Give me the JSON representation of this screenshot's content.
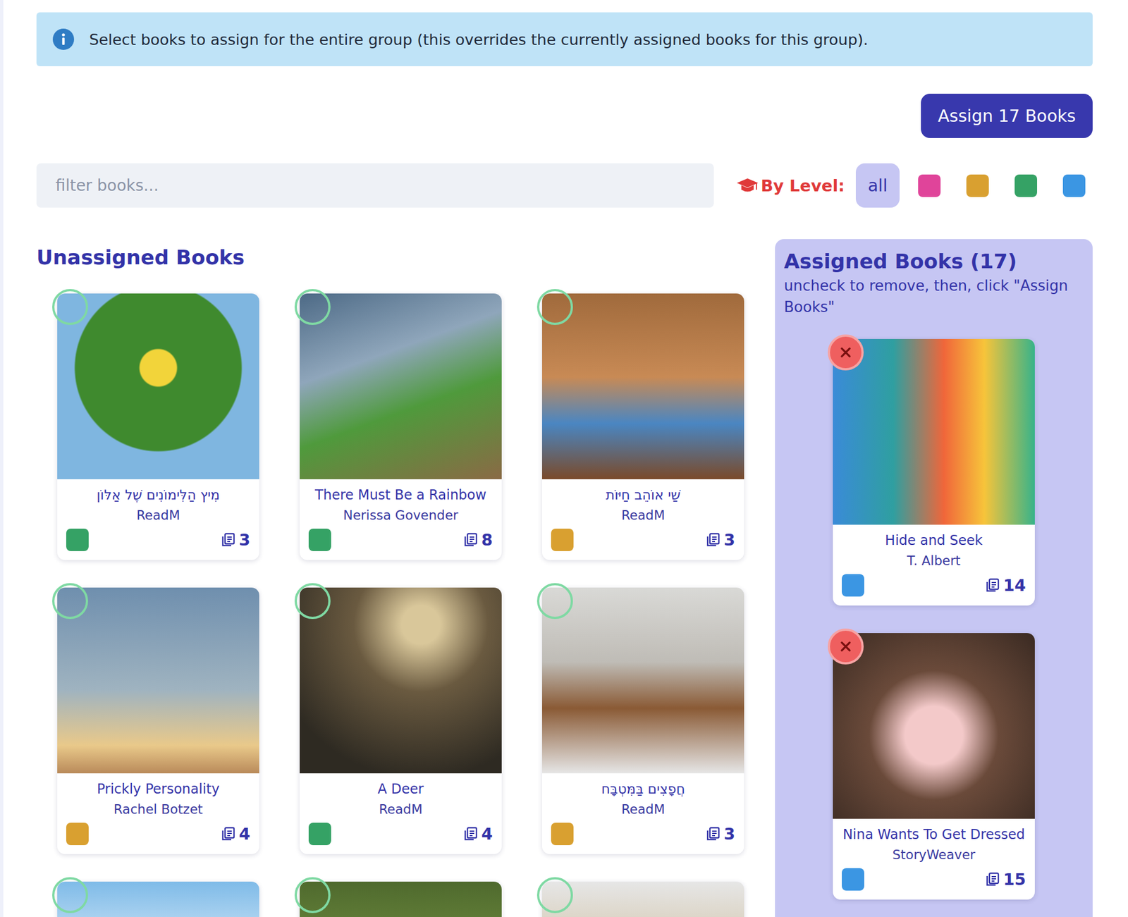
{
  "banner": {
    "text": "Select books to assign for the entire group (this overrides the currently assigned books for this group)."
  },
  "assign_button": {
    "label": "Assign 17 Books"
  },
  "filter": {
    "placeholder": "filter books..."
  },
  "level_filter": {
    "label": "By Level:",
    "options": [
      {
        "label": "all",
        "selected": true
      },
      {
        "color": "#e0449a",
        "selected": false
      },
      {
        "color": "#d9a030",
        "selected": false
      },
      {
        "color": "#35a265",
        "selected": false
      },
      {
        "color": "#3b96e3",
        "selected": false
      }
    ]
  },
  "unassigned": {
    "title": "Unassigned Books",
    "books": [
      {
        "title": "מִיץ הַלִּימוֹנִים שֶׁל אַלּוֹן",
        "author": "ReadM",
        "color": "#35a265",
        "pages": "3",
        "checked": false
      },
      {
        "title": "There Must Be a Rainbow",
        "author": "Nerissa Govender",
        "color": "#35a265",
        "pages": "8",
        "checked": false
      },
      {
        "title": "שַׁי אוֹהֵב חַיּוֹת",
        "author": "ReadM",
        "color": "#d9a030",
        "pages": "3",
        "checked": false
      },
      {
        "title": "Prickly Personality",
        "author": "Rachel Botzet",
        "color": "#d9a030",
        "pages": "4",
        "checked": false
      },
      {
        "title": "A Deer",
        "author": "ReadM",
        "color": "#35a265",
        "pages": "4",
        "checked": false
      },
      {
        "title": "חֲפָצִים בַּמִּטְבָּח",
        "author": "ReadM",
        "color": "#d9a030",
        "pages": "3",
        "checked": false
      },
      {
        "checked": false
      },
      {
        "checked": false
      },
      {
        "checked": false
      }
    ]
  },
  "assigned": {
    "title": "Assigned Books (17)",
    "hint": "uncheck to remove, then, click \"Assign Books\"",
    "books": [
      {
        "title": "Hide and Seek",
        "author": "T. Albert",
        "color": "#3b96e3",
        "pages": "14",
        "checked": true
      },
      {
        "title": "Nina Wants To Get Dressed",
        "author": "StoryWeaver",
        "color": "#3b96e3",
        "pages": "15",
        "checked": true
      }
    ]
  }
}
